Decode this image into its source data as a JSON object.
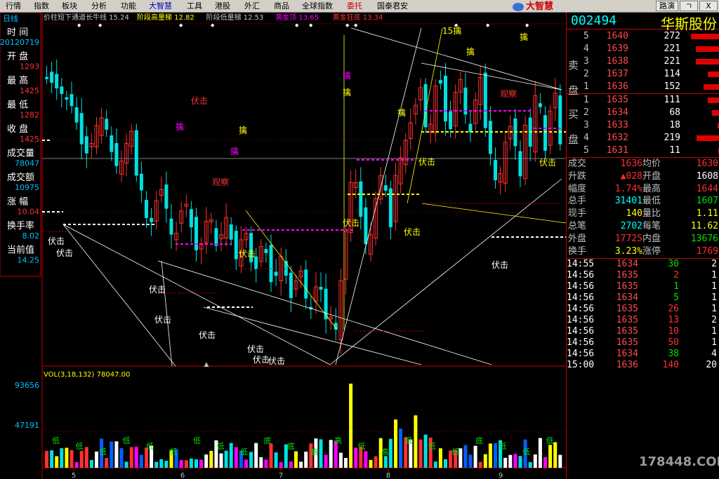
{
  "menu": [
    "行情",
    "指数",
    "板块",
    "分析",
    "功能",
    "大智慧",
    "工具",
    "港股",
    "外汇",
    "商品",
    "全球指数",
    "委托",
    "国泰君安"
  ],
  "menu_colors": {
    "大智慧": "#0000c8",
    "委托": "#d00000"
  },
  "brand": "大智慧",
  "window_buttons": [
    "路演",
    "ㄱ",
    "X"
  ],
  "period": "日线",
  "overlay_legend": [
    {
      "text": "价柱短下通道长牛线 15.24",
      "color": "#c0c0c0"
    },
    {
      "text": "阶段高量梯 12.82",
      "color": "#ffff00"
    },
    {
      "text": "阶段低量梯 12.53",
      "color": "#c0c0c0"
    },
    {
      "text": "黄金顶 13.65",
      "color": "#ff00ff"
    },
    {
      "text": "黄金狂底 13.34",
      "color": "#ff3030"
    }
  ],
  "info_panel": [
    {
      "label": "时 间",
      "value": "20120719",
      "color": "#00c0ff"
    },
    {
      "label": "开 盘",
      "value": "1293",
      "color": "#ff3030"
    },
    {
      "label": "最 高",
      "value": "1425",
      "color": "#ff3030"
    },
    {
      "label": "最 低",
      "value": "1282",
      "color": "#ff3030"
    },
    {
      "label": "收 盘",
      "value": "1425",
      "color": "#ff3030"
    },
    {
      "label": "成交量",
      "value": "78047",
      "color": "#00c0ff"
    },
    {
      "label": "成交额",
      "value": "10975",
      "color": "#00c0ff"
    },
    {
      "label": "涨 幅",
      "value": "10.04",
      "color": "#ff3030"
    },
    {
      "label": "换手率",
      "value": "8.02",
      "color": "#00c0ff"
    },
    {
      "label": "当前值",
      "value": "14.25",
      "color": "#00c0ff"
    }
  ],
  "annotations": [
    {
      "t": "伏击",
      "c": "#ff3030"
    },
    {
      "t": "观察",
      "c": "#ff3030"
    },
    {
      "t": "观察",
      "c": "#ff3030"
    },
    {
      "t": "擒",
      "c": "#ff00ff"
    },
    {
      "t": "擒",
      "c": "#ff00ff"
    },
    {
      "t": "擒",
      "c": "#ff00ff"
    },
    {
      "t": "擒",
      "c": "#ffff00"
    },
    {
      "t": "擒",
      "c": "#ffff00"
    },
    {
      "t": "擒",
      "c": "#ffff00"
    },
    {
      "t": "擒",
      "c": "#ffff00"
    },
    {
      "t": "擒",
      "c": "#ffff00"
    },
    {
      "t": "15擒",
      "c": "#ffff00"
    },
    {
      "t": "伏击",
      "c": "#ffffff"
    },
    {
      "t": "伏击",
      "c": "#ffffff"
    },
    {
      "t": "伏击",
      "c": "#ffffff"
    },
    {
      "t": "伏击",
      "c": "#ffffff"
    },
    {
      "t": "伏击",
      "c": "#ffffff"
    },
    {
      "t": "伏击",
      "c": "#ffffff"
    },
    {
      "t": "伏击",
      "c": "#ffffff"
    },
    {
      "t": "伏击",
      "c": "#ffffff"
    },
    {
      "t": "伏击",
      "c": "#ffffff"
    },
    {
      "t": "伏击",
      "c": "#ffff00"
    },
    {
      "t": "伏击",
      "c": "#ffff00"
    },
    {
      "t": "伏击",
      "c": "#ffff00"
    },
    {
      "t": "伏击",
      "c": "#ffff00"
    },
    {
      "t": "伏击",
      "c": "#ffff00"
    }
  ],
  "volume": {
    "header": "VOL(3,18,132)  78047.00",
    "axis": [
      "93656",
      "47191"
    ],
    "markers": [
      "低",
      "低",
      "低",
      "低",
      "低",
      "低",
      "低",
      "低",
      "低",
      "底",
      "底",
      "高",
      "高",
      "低",
      "高",
      "低",
      "低",
      "低",
      "底",
      "低",
      "低",
      "低"
    ]
  },
  "x_axis": [
    "5",
    "6",
    "7",
    "8",
    "9"
  ],
  "quote": {
    "code": "002494",
    "name": "华斯股份",
    "sell_label": [
      "卖",
      "盘"
    ],
    "buy_label": [
      "买",
      "盘"
    ],
    "sell": [
      {
        "n": "5",
        "p": "1640",
        "v": "272",
        "bar": 0.85
      },
      {
        "n": "4",
        "p": "1639",
        "v": "221",
        "bar": 0.7
      },
      {
        "n": "3",
        "p": "1638",
        "v": "221",
        "bar": 0.7
      },
      {
        "n": "2",
        "p": "1637",
        "v": "114",
        "bar": 0.36
      },
      {
        "n": "1",
        "p": "1636",
        "v": "152",
        "bar": 0.48
      }
    ],
    "buy": [
      {
        "n": "1",
        "p": "1635",
        "v": "111",
        "bar": 0.35
      },
      {
        "n": "2",
        "p": "1634",
        "v": "68",
        "bar": 0.22
      },
      {
        "n": "3",
        "p": "1633",
        "v": "18",
        "bar": 0.06
      },
      {
        "n": "4",
        "p": "1632",
        "v": "219",
        "bar": 0.69
      },
      {
        "n": "5",
        "p": "1631",
        "v": "11",
        "bar": 0.04
      }
    ],
    "stats": [
      {
        "l1": "成交",
        "v1": "1636",
        "c1": "#ff3030",
        "l2": "均价",
        "v2": "1630",
        "c2": "#ff3030"
      },
      {
        "l1": "升跌",
        "v1": "▲028",
        "c1": "#ff3030",
        "l2": "开盘",
        "v2": "1608",
        "c2": "#ffffff"
      },
      {
        "l1": "幅度",
        "v1": "1.74%",
        "c1": "#ff3030",
        "l2": "最高",
        "v2": "1644",
        "c2": "#ff3030"
      },
      {
        "l1": "总手",
        "v1": "31401",
        "c1": "#00ffff",
        "l2": "最低",
        "v2": "1607",
        "c2": "#00e000"
      },
      {
        "l1": "现手",
        "v1": "140",
        "c1": "#ffff00",
        "l2": "量比",
        "v2": "1.11",
        "c2": "#ffff00"
      },
      {
        "l1": "总笔",
        "v1": "2702",
        "c1": "#00ffff",
        "l2": "每笔",
        "v2": "11.62",
        "c2": "#ffff00"
      },
      {
        "l1": "外盘",
        "v1": "17725",
        "c1": "#ff3030",
        "l2": "内盘",
        "v2": "13676",
        "c2": "#00e000"
      },
      {
        "l1": "换手",
        "v1": "3.23%",
        "c1": "#ffff00",
        "l2": "涨停",
        "v2": "1769",
        "c2": "#ff3030"
      }
    ],
    "ticks": [
      {
        "t": "14:55",
        "p": "1634",
        "v": "30",
        "n": "2",
        "vc": "#00e000"
      },
      {
        "t": "14:56",
        "p": "1635",
        "v": "2",
        "n": "1",
        "vc": "#ff3030"
      },
      {
        "t": "14:56",
        "p": "1635",
        "v": "1",
        "n": "1",
        "vc": "#00e000"
      },
      {
        "t": "14:56",
        "p": "1634",
        "v": "5",
        "n": "1",
        "vc": "#00e000"
      },
      {
        "t": "14:56",
        "p": "1635",
        "v": "26",
        "n": "1",
        "vc": "#ff3030"
      },
      {
        "t": "14:56",
        "p": "1635",
        "v": "13",
        "n": "2",
        "vc": "#ff3030"
      },
      {
        "t": "14:56",
        "p": "1635",
        "v": "10",
        "n": "1",
        "vc": "#ff3030"
      },
      {
        "t": "14:56",
        "p": "1635",
        "v": "50",
        "n": "1",
        "vc": "#ff3030"
      },
      {
        "t": "14:56",
        "p": "1634",
        "v": "38",
        "n": "4",
        "vc": "#00e000"
      },
      {
        "t": "15:00",
        "p": "1636",
        "v": "140",
        "n": "20",
        "vc": "#ff3030"
      }
    ]
  },
  "watermark": "178448.COM"
}
